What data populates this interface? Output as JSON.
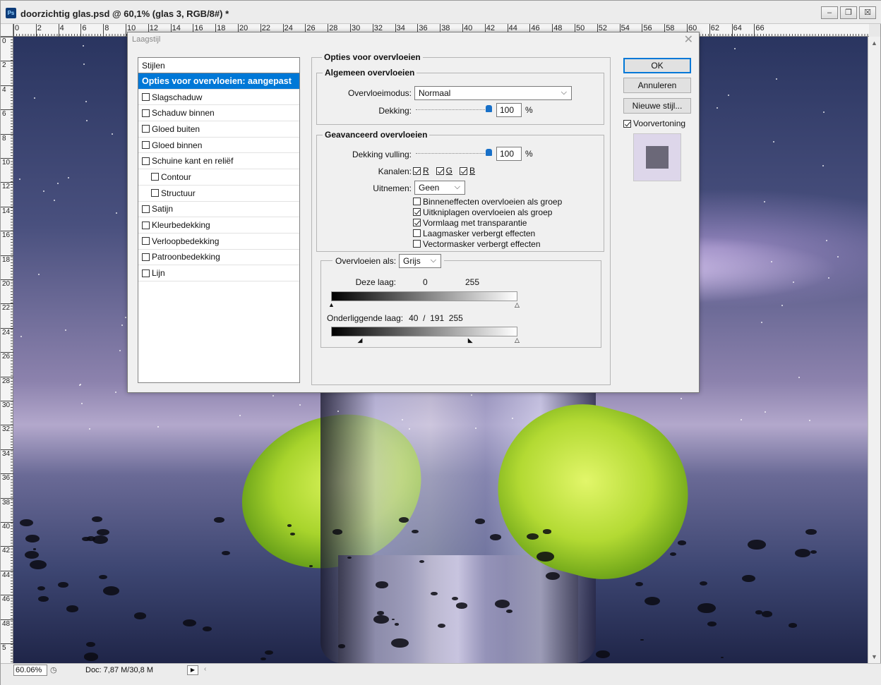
{
  "window": {
    "title": "doorzichtig glas.psd @ 60,1% (glas 3, RGB/8#) *",
    "app_icon": "Ps",
    "minimize": "–",
    "restore": "❐",
    "close": "☒"
  },
  "ruler": {
    "top_ticks": [
      "0",
      "2",
      "4",
      "6",
      "8",
      "10",
      "12",
      "14",
      "16",
      "18",
      "20",
      "22",
      "24",
      "26",
      "28",
      "30",
      "32",
      "34",
      "36",
      "38",
      "40",
      "42",
      "44",
      "46",
      "48",
      "50",
      "52",
      "54",
      "56",
      "58",
      "60",
      "62",
      "64",
      "66"
    ],
    "left_ticks": [
      "0",
      "2",
      "4",
      "6",
      "8",
      "10",
      "12",
      "14",
      "16",
      "18",
      "20",
      "22",
      "24",
      "26",
      "28",
      "30",
      "32",
      "34",
      "36",
      "38",
      "40",
      "42",
      "44",
      "46",
      "48",
      "5"
    ]
  },
  "status": {
    "zoom": "60.06%",
    "doc": "Doc: 7,87 M/30,8 M",
    "arrow": "▶"
  },
  "dialog": {
    "title": "Laagstijl",
    "close": "✕",
    "styles_header": "Stijlen",
    "styles": [
      {
        "label": "Opties voor overvloeien: aangepast",
        "active": true,
        "checkbox": false,
        "checked": false,
        "indent": false
      },
      {
        "label": "Slagschaduw",
        "active": false,
        "checkbox": true,
        "checked": false,
        "indent": false
      },
      {
        "label": "Schaduw binnen",
        "active": false,
        "checkbox": true,
        "checked": false,
        "indent": false
      },
      {
        "label": "Gloed buiten",
        "active": false,
        "checkbox": true,
        "checked": false,
        "indent": false
      },
      {
        "label": "Gloed binnen",
        "active": false,
        "checkbox": true,
        "checked": false,
        "indent": false
      },
      {
        "label": "Schuine kant en reliëf",
        "active": false,
        "checkbox": true,
        "checked": false,
        "indent": false
      },
      {
        "label": "Contour",
        "active": false,
        "checkbox": true,
        "checked": false,
        "indent": true
      },
      {
        "label": "Structuur",
        "active": false,
        "checkbox": true,
        "checked": false,
        "indent": true
      },
      {
        "label": "Satijn",
        "active": false,
        "checkbox": true,
        "checked": false,
        "indent": false
      },
      {
        "label": "Kleurbedekking",
        "active": false,
        "checkbox": true,
        "checked": false,
        "indent": false
      },
      {
        "label": "Verloopbedekking",
        "active": false,
        "checkbox": true,
        "checked": false,
        "indent": false
      },
      {
        "label": "Patroonbedekking",
        "active": false,
        "checkbox": true,
        "checked": false,
        "indent": false
      },
      {
        "label": "Lijn",
        "active": false,
        "checkbox": true,
        "checked": false,
        "indent": false
      }
    ],
    "blending": {
      "title": "Opties voor overvloeien",
      "general": {
        "title": "Algemeen overvloeien",
        "mode_label": "Overvloeimodus:",
        "mode_value": "Normaal",
        "opacity_label": "Dekking:",
        "opacity_value": "100",
        "opacity_fraction": 1.0,
        "pct": "%"
      },
      "advanced": {
        "title": "Geavanceerd overvloeien",
        "fill_label": "Dekking vulling:",
        "fill_value": "100",
        "fill_fraction": 1.0,
        "pct": "%",
        "channels_label": "Kanalen:",
        "channels": [
          {
            "label": "R",
            "checked": true
          },
          {
            "label": "G",
            "checked": true
          },
          {
            "label": "B",
            "checked": true
          }
        ],
        "knockout_label": "Uitnemen:",
        "knockout_value": "Geen",
        "options": [
          {
            "label": "Binneneffecten overvloeien als groep",
            "checked": false
          },
          {
            "label": "Uitkniplagen overvloeien als groep",
            "checked": true
          },
          {
            "label": "Vormlaag met transparantie",
            "checked": true
          },
          {
            "label": "Laagmasker verbergt effecten",
            "checked": false
          },
          {
            "label": "Vectormasker verbergt effecten",
            "checked": false
          }
        ]
      },
      "blend_if": {
        "label": "Overvloeien als:",
        "value": "Grijs",
        "this_layer_label": "Deze laag:",
        "this_layer_low": "0",
        "this_layer_high": "255",
        "underlying_label": "Onderliggende laag:",
        "underlying_values": "40  /  191  255",
        "underlying_low_fraction": 0.157,
        "underlying_split_fraction": 0.749
      }
    },
    "buttons": {
      "ok": "OK",
      "cancel": "Annuleren",
      "new_style": "Nieuwe stijl...",
      "preview": "Voorvertoning",
      "preview_checked": true
    }
  },
  "colors": {
    "accent": "#0078d7",
    "slider_thumb": "#1870c8",
    "preview_swatch": "#6b6878"
  }
}
